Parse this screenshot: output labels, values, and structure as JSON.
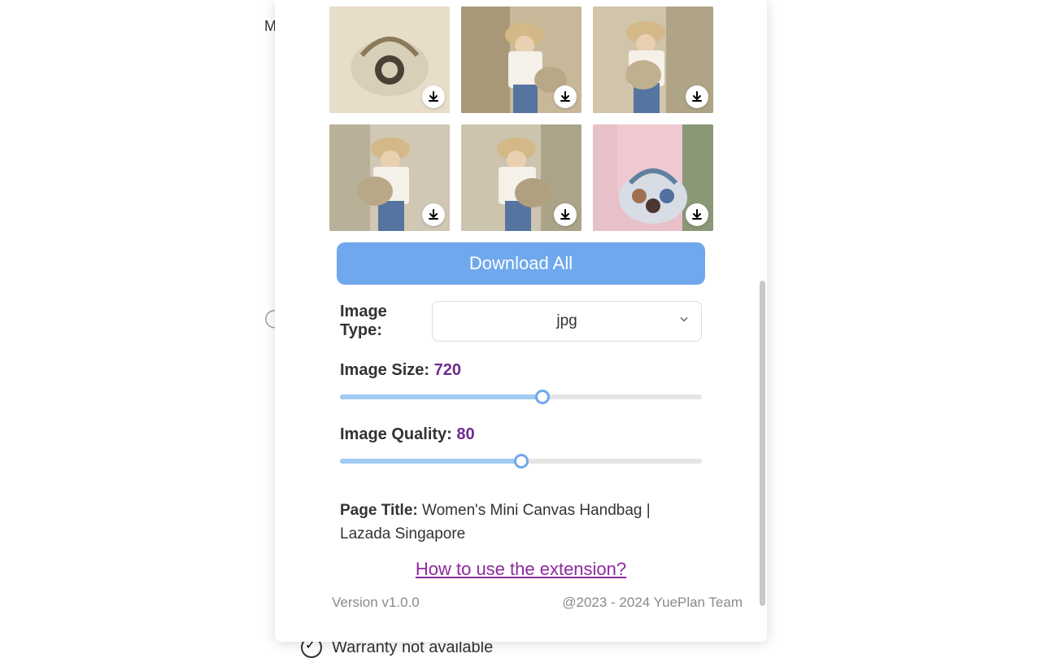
{
  "background": {
    "letter": "M",
    "warranty_text": "Warranty not available"
  },
  "grid": {
    "items": [
      {
        "desc": "handbag product"
      },
      {
        "desc": "model with bag 1"
      },
      {
        "desc": "model with bag 2"
      },
      {
        "desc": "model with bag 3"
      },
      {
        "desc": "model with bag 4"
      },
      {
        "desc": "model with patterned bag"
      }
    ]
  },
  "controls": {
    "download_all_label": "Download All",
    "image_type_label": "Image Type:",
    "image_type_value": "jpg",
    "image_size_label": "Image Size: ",
    "image_size_value": "720",
    "image_size_percent": 56,
    "image_quality_label": "Image Quality: ",
    "image_quality_value": "80",
    "image_quality_percent": 50
  },
  "page_info": {
    "title_label": "Page Title: ",
    "title_value": "Women's Mini Canvas Handbag | Lazada Singapore"
  },
  "help_link": "How to use the extension?",
  "footer": {
    "version": "Version v1.0.0",
    "copyright": "@2023 - 2024 YuePlan Team"
  }
}
